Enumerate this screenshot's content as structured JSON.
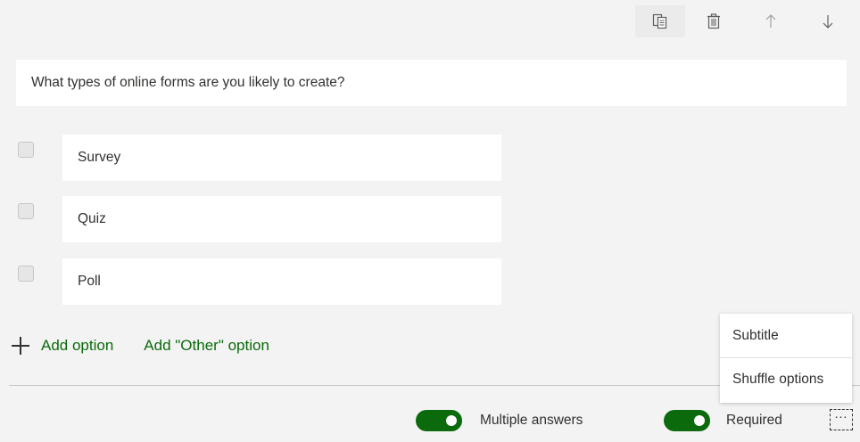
{
  "toolbar": {
    "icons": [
      "copy-icon",
      "delete-icon",
      "move-up-icon",
      "move-down-icon"
    ]
  },
  "question": {
    "text": "What types of online forms are you likely to create?"
  },
  "options": [
    {
      "label": "Survey"
    },
    {
      "label": "Quiz"
    },
    {
      "label": "Poll"
    }
  ],
  "add": {
    "option_label": "Add option",
    "other_label": "Add \"Other\" option"
  },
  "footer": {
    "multiple_answers_label": "Multiple answers",
    "required_label": "Required",
    "more_label": "..."
  },
  "menu": {
    "subtitle_label": "Subtitle",
    "shuffle_label": "Shuffle options"
  },
  "colors": {
    "accent": "#0b6a0b",
    "background": "#f3f3f3"
  }
}
